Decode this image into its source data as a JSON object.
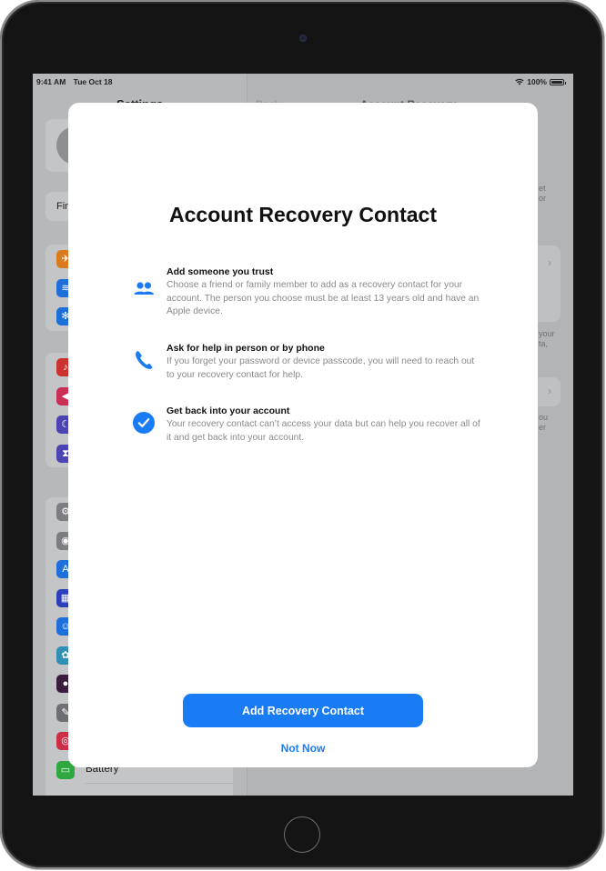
{
  "status_bar": {
    "time": "9:41 AM",
    "date": "Tue Oct 18",
    "battery_percent": "100%"
  },
  "background": {
    "sidebar": {
      "title": "Settings",
      "profile_card_text": "",
      "search_card_text": "Fin",
      "groups": [
        {
          "items": [
            {
              "icon": "airplane-icon",
              "color": "#d97a1c",
              "glyph": "✈"
            },
            {
              "icon": "wifi-icon",
              "color": "#1e6fd9",
              "glyph": "≋"
            },
            {
              "icon": "bluetooth-icon",
              "color": "#1e6fd9",
              "glyph": "✻"
            }
          ]
        },
        {
          "items": [
            {
              "icon": "notifications-icon",
              "color": "#cc3330",
              "glyph": "🔔"
            },
            {
              "icon": "sounds-icon",
              "color": "#cc2f55",
              "glyph": "◀"
            },
            {
              "icon": "focus-icon",
              "color": "#4b45b3",
              "glyph": "☾"
            },
            {
              "icon": "screen-time-icon",
              "color": "#4b45b3",
              "glyph": "⧗"
            }
          ]
        },
        {
          "items": [
            {
              "icon": "general-icon",
              "color": "#7c7d80",
              "glyph": "⚙",
              "label": ""
            },
            {
              "icon": "control-center-icon",
              "color": "#7c7d80",
              "glyph": "◉",
              "label": ""
            },
            {
              "icon": "display-icon",
              "color": "#1e6fd9",
              "glyph": "A",
              "label": ""
            },
            {
              "icon": "home-screen-icon",
              "color": "#2d3fb8",
              "glyph": "▦",
              "label": ""
            },
            {
              "icon": "accessibility-icon",
              "color": "#1e6fd9",
              "glyph": "☺",
              "label": ""
            },
            {
              "icon": "wallpaper-icon",
              "color": "#2f8fb5",
              "glyph": "✿",
              "label": ""
            },
            {
              "icon": "siri-icon",
              "color": "#3a1d3d",
              "glyph": "●",
              "label": ""
            },
            {
              "icon": "apple-pencil-icon",
              "color": "#6e6f72",
              "glyph": "✎",
              "label": ""
            },
            {
              "icon": "touch-id-icon",
              "color": "#cc2f45",
              "glyph": "◎",
              "label": ""
            },
            {
              "icon": "battery-icon",
              "color": "#2fa83f",
              "glyph": "▭",
              "label": "Battery"
            }
          ]
        }
      ]
    },
    "detail": {
      "back_label": "Back",
      "title": "Account Recovery",
      "text_fragments": [
        "et",
        "or",
        "your",
        "ta,",
        "ou",
        "er"
      ]
    }
  },
  "modal": {
    "title": "Account Recovery Contact",
    "features": [
      {
        "icon": "people-icon",
        "title": "Add someone you trust",
        "description": "Choose a friend or family member to add as a recovery contact for your account. The person you choose must be at least 13 years old and have an Apple device."
      },
      {
        "icon": "phone-icon",
        "title": "Ask for help in person or by phone",
        "description": "If you forget your password or device passcode, you will need to reach out to your recovery contact for help."
      },
      {
        "icon": "checkmark-circle-icon",
        "title": "Get back into your account",
        "description": "Your recovery contact can’t access your data but can help you recover all of it and get back into your account."
      }
    ],
    "primary_button": "Add Recovery Contact",
    "secondary_button": "Not Now"
  },
  "colors": {
    "accent": "#1a7cf5",
    "title_text": "#111111",
    "secondary_text": "#8a8a8e",
    "dim_background": "#b3b4b6"
  }
}
